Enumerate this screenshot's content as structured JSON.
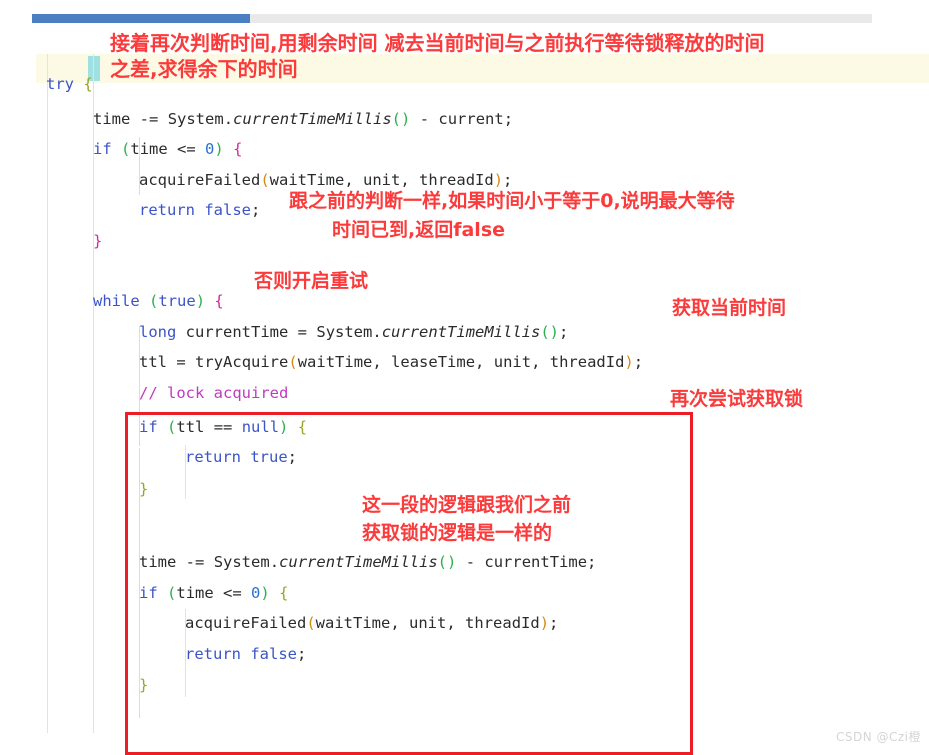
{
  "window": {
    "type": "code-editor-screenshot",
    "watermark": "CSDN @Czi橙"
  },
  "scrollbar": {
    "orientation": "horizontal",
    "thumb_color": "#4a7fc1",
    "track_color": "#e9e9e9"
  },
  "editor": {
    "language": "Java",
    "current_line_highlight_color": "#fcfae5",
    "brace_match_color": "#9fe0e0",
    "code_lines": [
      {
        "indent": 1,
        "text": "try {"
      },
      {
        "indent": 2,
        "text": "time -= System.currentTimeMillis() - current;"
      },
      {
        "indent": 2,
        "text": "if (time <= 0) {"
      },
      {
        "indent": 3,
        "text": "acquireFailed(waitTime, unit, threadId);"
      },
      {
        "indent": 3,
        "text": "return false;"
      },
      {
        "indent": 2,
        "text": "}"
      },
      {
        "indent": 2,
        "text": ""
      },
      {
        "indent": 2,
        "text": "while (true) {"
      },
      {
        "indent": 3,
        "text": "long currentTime = System.currentTimeMillis();"
      },
      {
        "indent": 3,
        "text": "ttl = tryAcquire(waitTime, leaseTime, unit, threadId);"
      },
      {
        "indent": 3,
        "text": "// lock acquired"
      },
      {
        "indent": 3,
        "text": "if (ttl == null) {"
      },
      {
        "indent": 4,
        "text": "return true;"
      },
      {
        "indent": 3,
        "text": "}"
      },
      {
        "indent": 3,
        "text": ""
      },
      {
        "indent": 3,
        "text": "time -= System.currentTimeMillis() - currentTime;"
      },
      {
        "indent": 3,
        "text": "if (time <= 0) {"
      },
      {
        "indent": 4,
        "text": "acquireFailed(waitTime, unit, threadId);"
      },
      {
        "indent": 4,
        "text": "return false;"
      },
      {
        "indent": 3,
        "text": "}"
      }
    ]
  },
  "annotations": {
    "color": "#fb3b3b",
    "box_color": "#ec1d25",
    "items": [
      {
        "id": "anno-remaining-time",
        "lines": [
          "接着再次判断时间,用剩余时间 减去当前时间与之前执行等待锁释放的时间",
          "之差,求得余下的时间"
        ]
      },
      {
        "id": "anno-return-false",
        "lines": [
          "跟之前的判断一样,如果时间小于等于0,说明最大等待",
          "时间已到,返回false"
        ]
      },
      {
        "id": "anno-retry",
        "lines": [
          "否则开启重试"
        ]
      },
      {
        "id": "anno-get-current-time",
        "lines": [
          "获取当前时间"
        ]
      },
      {
        "id": "anno-try-acquire-again",
        "lines": [
          "再次尝试获取锁"
        ]
      },
      {
        "id": "anno-same-logic",
        "lines": [
          "这一段的逻辑跟我们之前",
          "获取锁的逻辑是一样的"
        ]
      }
    ]
  }
}
